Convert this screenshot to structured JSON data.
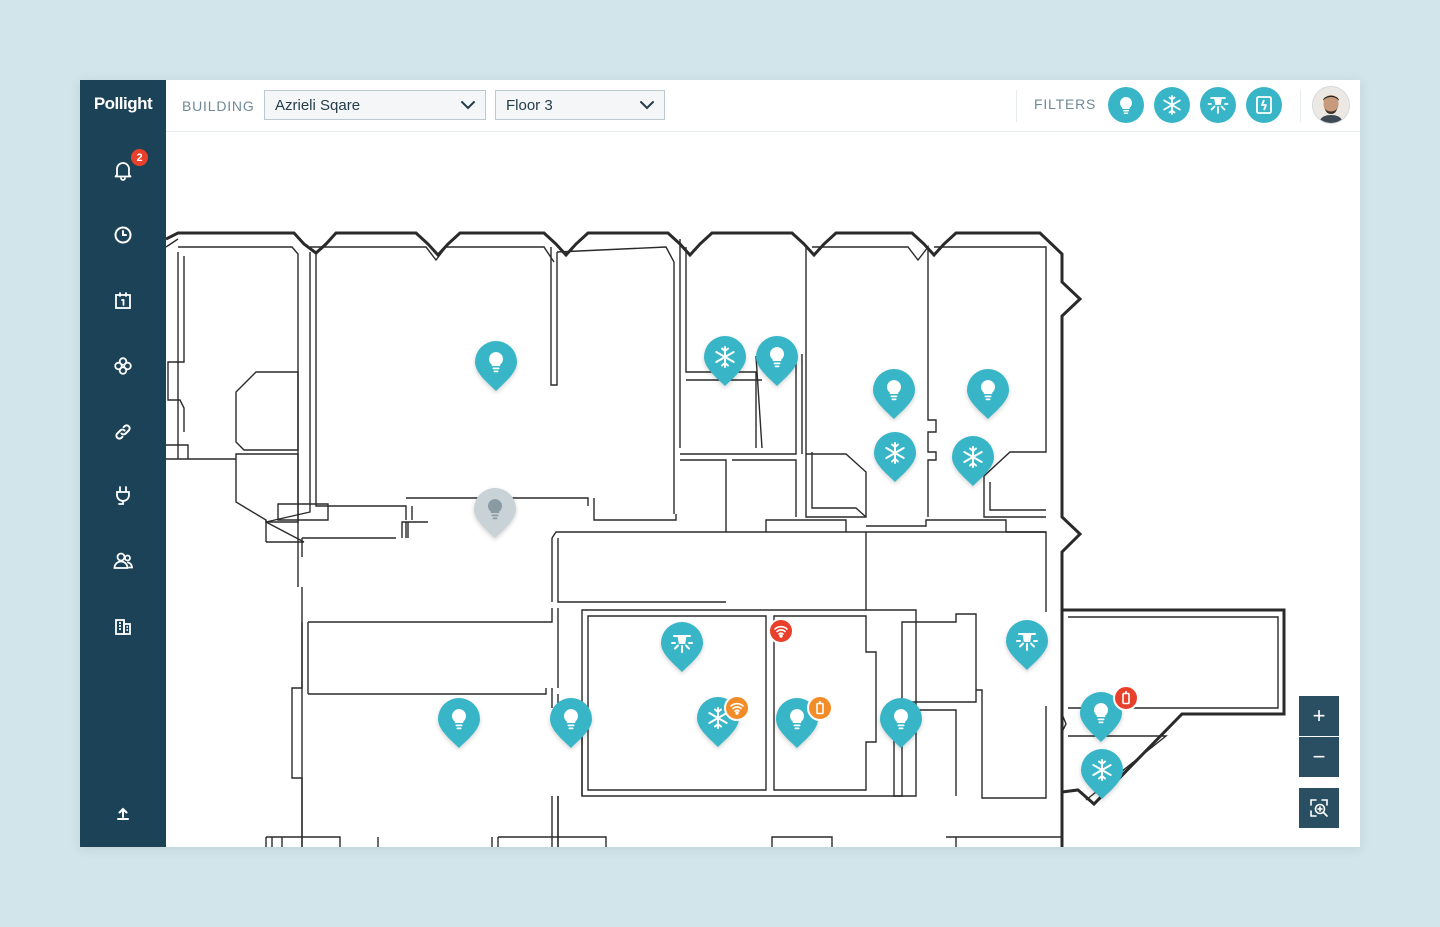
{
  "app": {
    "logo": "Pollight"
  },
  "sidebar": {
    "items": [
      {
        "name": "notifications",
        "icon": "bell-icon",
        "badge": "2"
      },
      {
        "name": "history",
        "icon": "clock-icon"
      },
      {
        "name": "schedule",
        "icon": "calendar-icon"
      },
      {
        "name": "scenes",
        "icon": "flower-icon"
      },
      {
        "name": "links",
        "icon": "link-icon"
      },
      {
        "name": "power",
        "icon": "plug-icon"
      },
      {
        "name": "users",
        "icon": "users-icon"
      },
      {
        "name": "buildings",
        "icon": "building-icon"
      }
    ],
    "bottom_icon": "upload-icon"
  },
  "topbar": {
    "building_label": "BUILDING",
    "building_value": "Azrieli Sqare",
    "floor_value": "Floor 3",
    "filters_label": "FILTERS",
    "filters": [
      "bulb-icon",
      "snowflake-icon",
      "spotlight-icon",
      "panel-icon"
    ]
  },
  "map": {
    "devices": [
      {
        "type": "bulb",
        "state": "on"
      },
      {
        "type": "bulb",
        "state": "off"
      },
      {
        "type": "ac",
        "state": "on"
      },
      {
        "type": "bulb",
        "state": "on"
      },
      {
        "type": "bulb",
        "state": "on"
      },
      {
        "type": "bulb",
        "state": "on"
      },
      {
        "type": "ac",
        "state": "on"
      },
      {
        "type": "ac",
        "state": "on"
      },
      {
        "type": "spot",
        "state": "on",
        "alert": "wifi",
        "alert_color": "#e8402a"
      },
      {
        "type": "spot",
        "state": "on"
      },
      {
        "type": "bulb",
        "state": "on"
      },
      {
        "type": "bulb",
        "state": "on"
      },
      {
        "type": "ac",
        "state": "on",
        "alert": "wifi",
        "alert_color": "#f28c28"
      },
      {
        "type": "bulb",
        "state": "on",
        "alert": "battery",
        "alert_color": "#f28c28"
      },
      {
        "type": "bulb",
        "state": "on"
      },
      {
        "type": "bulb",
        "state": "on",
        "alert": "battery",
        "alert_color": "#e8402a"
      },
      {
        "type": "ac",
        "state": "on"
      }
    ]
  },
  "zoom": {
    "in_label": "+",
    "out_label": "−",
    "fit_icon": "zoom-fit-icon"
  },
  "colors": {
    "sidebar": "#1c4257",
    "accent": "#38b6c8",
    "pin_off": "#c9d2d6",
    "alert_red": "#e8402a",
    "alert_orange": "#f28c28"
  }
}
